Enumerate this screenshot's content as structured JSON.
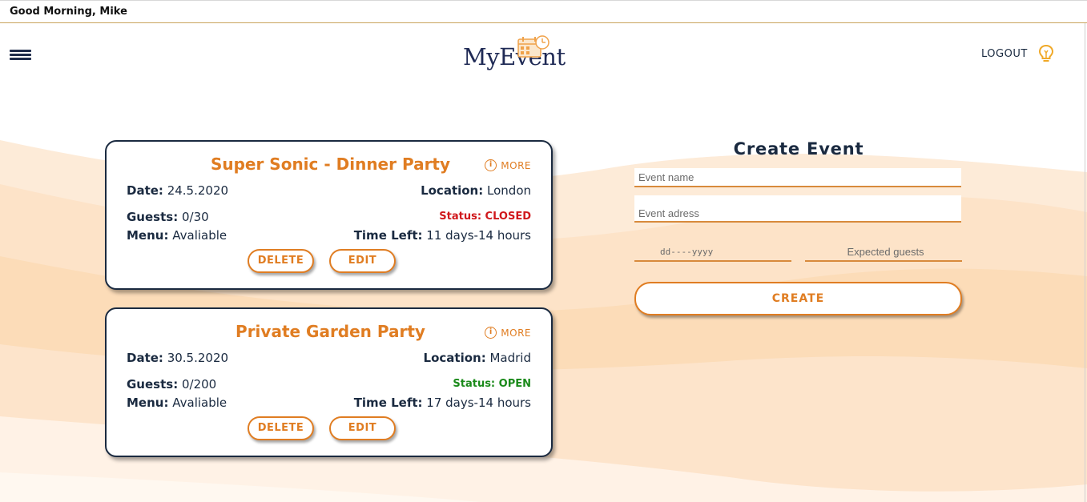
{
  "greeting": "Good Morning, Mike",
  "header": {
    "logo_text": "MyEvent",
    "logout_label": "LOGOUT"
  },
  "events": [
    {
      "title": "Super Sonic - Dinner Party",
      "more_label": "MORE",
      "date_label": "Date:",
      "date": "24.5.2020",
      "location_label": "Location:",
      "location": "London",
      "guests_label": "Guests:",
      "guests": "0/30",
      "status": "Status: CLOSED",
      "status_color": "#d0181c",
      "menu_label": "Menu:",
      "menu": "Avaliable",
      "time_left_label": "Time Left:",
      "time_left": "11 days-14 hours",
      "delete_label": "DELETE",
      "edit_label": "EDIT"
    },
    {
      "title": "Private Garden Party",
      "more_label": "MORE",
      "date_label": "Date:",
      "date": "30.5.2020",
      "location_label": "Location:",
      "location": "Madrid",
      "guests_label": "Guests:",
      "guests": "0/200",
      "status": "Status: OPEN",
      "status_color": "#1a8a1a",
      "menu_label": "Menu:",
      "menu": "Avaliable",
      "time_left_label": "Time Left:",
      "time_left": "17 days-14 hours",
      "delete_label": "DELETE",
      "edit_label": "EDIT"
    }
  ],
  "create_form": {
    "title": "Create Event",
    "name_placeholder": "Event name",
    "address_placeholder": "Event adress",
    "date_placeholder": "dd----yyyy",
    "guests_placeholder": "Expected guests",
    "create_label": "CREATE"
  },
  "colors": {
    "accent": "#e07d22",
    "navy": "#1a2a40",
    "wave": "#fcd9b0"
  },
  "icons": [
    "menu-icon",
    "calendar-clock-icon",
    "lightbulb-icon",
    "info-icon"
  ]
}
